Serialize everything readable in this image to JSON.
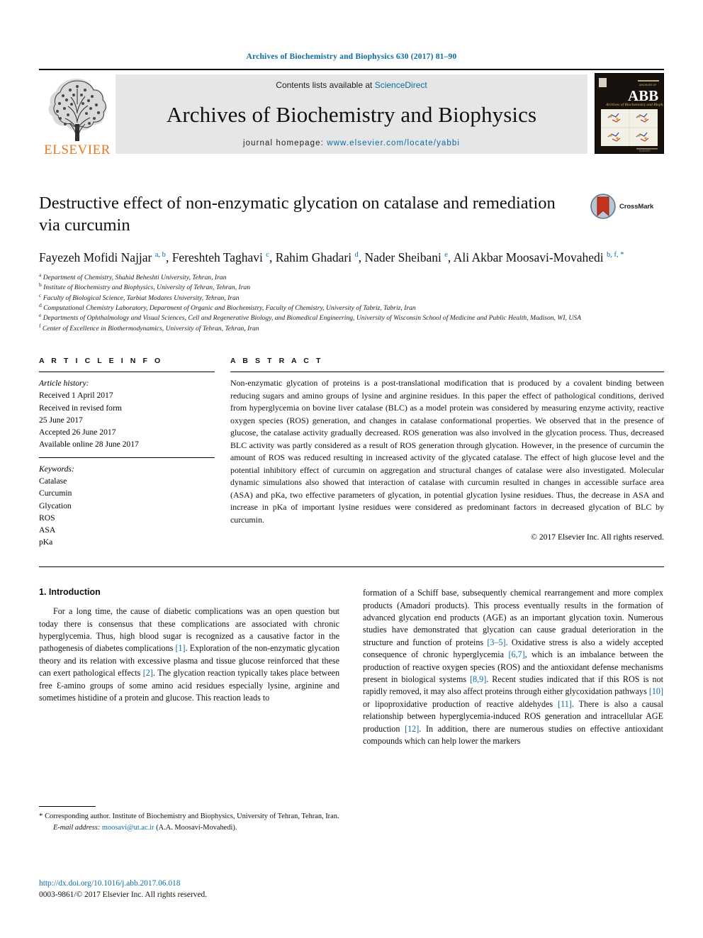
{
  "running_head": "Archives of Biochemistry and Biophysics 630 (2017) 81–90",
  "masthead": {
    "publisher_name": "ELSEVIER",
    "contents_prefix": "Contents lists available at ",
    "contents_link": "ScienceDirect",
    "journal_name": "Archives of Biochemistry and Biophysics",
    "homepage_label": "journal homepage: ",
    "homepage_url": "www.elsevier.com/locate/yabbi",
    "cover_title": "ABB",
    "cover_subtitle": "Archives of Biochemistry and Biophysics"
  },
  "article": {
    "title": "Destructive effect of non-enzymatic glycation on catalase and remediation via curcumin",
    "crossmark_label": "CrossMark",
    "authors": [
      {
        "name": "Fayezeh Mofidi Najjar",
        "marks": "a, b",
        "sep": ", "
      },
      {
        "name": "Fereshteh Taghavi",
        "marks": "c",
        "sep": ", "
      },
      {
        "name": "Rahim Ghadari",
        "marks": "d",
        "sep": ", "
      },
      {
        "name": "Nader Sheibani",
        "marks": "e",
        "sep": ", "
      },
      {
        "name": "Ali Akbar Moosavi-Movahedi",
        "marks": "b, f, *",
        "sep": ""
      }
    ],
    "affiliations": [
      {
        "mark": "a",
        "text": "Department of Chemistry, Shahid Beheshti University, Tehran, Iran"
      },
      {
        "mark": "b",
        "text": "Institute of Biochemistry and Biophysics, University of Tehran, Tehran, Iran"
      },
      {
        "mark": "c",
        "text": "Faculty of Biological Science, Tarbiat Modares University, Tehran, Iran"
      },
      {
        "mark": "d",
        "text": "Computational Chemistry Laboratory, Department of Organic and Biochemistry, Faculty of Chemistry, University of Tabriz, Tabriz, Iran"
      },
      {
        "mark": "e",
        "text": "Departments of Ophthalmology and Visual Sciences, Cell and Regenerative Biology, and Biomedical Engineering, University of Wisconsin School of Medicine and Public Health, Madison, WI, USA"
      },
      {
        "mark": "f",
        "text": "Center of Excellence in Biothermodynamics, University of Tehran, Tehran, Iran"
      }
    ]
  },
  "article_info": {
    "heading": "A R T I C L E   I N F O",
    "history_title": "Article history:",
    "history_lines": [
      "Received 1 April 2017",
      "Received in revised form",
      "25 June 2017",
      "Accepted 26 June 2017",
      "Available online 28 June 2017"
    ],
    "keywords_title": "Keywords:",
    "keywords": [
      "Catalase",
      "Curcumin",
      "Glycation",
      "ROS",
      "ASA",
      "pKa"
    ]
  },
  "abstract": {
    "heading": "A B S T R A C T",
    "text": "Non-enzymatic glycation of proteins is a post-translational modification that is produced by a covalent binding between reducing sugars and amino groups of lysine and arginine residues. In this paper the effect of pathological conditions, derived from hyperglycemia on bovine liver catalase (BLC) as a model protein was considered by measuring enzyme activity, reactive oxygen species (ROS) generation, and changes in catalase conformational properties. We observed that in the presence of glucose, the catalase activity gradually decreased. ROS generation was also involved in the glycation process. Thus, decreased BLC activity was partly considered as a result of ROS generation through glycation. However, in the presence of curcumin the amount of ROS was reduced resulting in increased activity of the glycated catalase. The effect of high glucose level and the potential inhibitory effect of curcumin on aggregation and structural changes of catalase were also investigated. Molecular dynamic simulations also showed that interaction of catalase with curcumin resulted in changes in accessible surface area (ASA) and pKa, two effective parameters of glycation, in potential glycation lysine residues. Thus, the decrease in ASA and increase in pKa of important lysine residues were considered as predominant factors in decreased glycation of BLC by curcumin.",
    "copyright": "© 2017 Elsevier Inc. All rights reserved."
  },
  "body": {
    "section_number_title": "1.  Introduction",
    "left_paragraph_html": "For a long time, the cause of diabetic complications was an open question but today there is consensus that these complications are associated with chronic hyperglycemia. Thus, high blood sugar is recognized as a causative factor in the pathogenesis of diabetes complications <span class=\"ref\">[1]</span>. Exploration of the non-enzymatic glycation theory and its relation with excessive plasma and tissue glucose reinforced that these can exert pathological effects <span class=\"ref\">[2]</span>. The glycation reaction typically takes place between free Ɛ-amino groups of some amino acid residues especially lysine, arginine and sometimes histidine of a protein and glucose. This reaction leads to",
    "right_paragraph_html": "formation of a Schiff base, subsequently chemical rearrangement and more complex products (Amadori products). This process eventually results in the formation of advanced glycation end products (AGE) as an important glycation toxin. Numerous studies have demonstrated that glycation can cause gradual deterioration in the structure and function of proteins <span class=\"ref\">[3–5]</span>. Oxidative stress is also a widely accepted consequence of chronic hyperglycemia <span class=\"ref\">[6,7]</span>, which is an imbalance between the production of reactive oxygen species (ROS) and the antioxidant defense mechanisms present in biological systems <span class=\"ref\">[8,9]</span>. Recent studies indicated that if this ROS is not rapidly removed, it may also affect proteins through either glycoxidation pathways <span class=\"ref\">[10]</span> or lipoproxidative production of reactive aldehydes <span class=\"ref\">[11]</span>. There is also a causal relationship between hyperglycemia-induced ROS generation and intracellular AGE production <span class=\"ref\">[12]</span>. In addition, there are numerous studies on effective antioxidant compounds which can help lower the markers"
  },
  "footnote": {
    "star": "*",
    "corresponding": "Corresponding author. Institute of Biochemistry and Biophysics, University of Tehran, Tehran, Iran.",
    "email_label": "E-mail address:",
    "email": "moosavi@ut.ac.ir",
    "email_owner": "(A.A. Moosavi-Movahedi)."
  },
  "footer": {
    "doi": "http://dx.doi.org/10.1016/j.abb.2017.06.018",
    "issn_line": "0003-9861/© 2017 Elsevier Inc. All rights reserved."
  },
  "colors": {
    "link_blue": "#0b6ba6",
    "elsevier_orange": "#e87722",
    "masthead_gray": "#e6e6e6"
  }
}
